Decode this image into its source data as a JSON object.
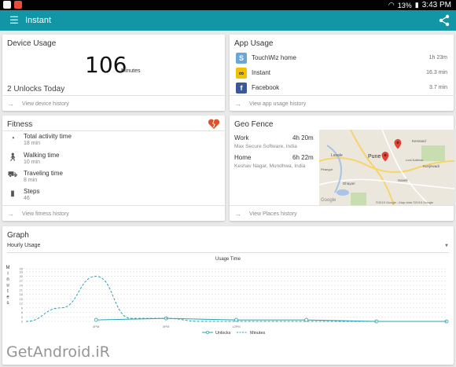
{
  "status_bar": {
    "battery": "13%",
    "time": "3:43 PM"
  },
  "app_bar": {
    "title": "Instant"
  },
  "device_usage": {
    "title": "Device Usage",
    "minutes": "106",
    "minutes_unit": "Minutes",
    "unlocks": "2 Unlocks Today",
    "link": "View device history"
  },
  "app_usage": {
    "title": "App Usage",
    "apps": [
      {
        "name": "TouchWiz home",
        "time": "1h 23m",
        "color": "#6aa7d8"
      },
      {
        "name": "Instant",
        "time": "16.3 min",
        "color": "#f2c100"
      },
      {
        "name": "Facebook",
        "time": "3.7 min",
        "color": "#3b5998"
      }
    ],
    "link": "View app usage history"
  },
  "fitness": {
    "title": "Fitness",
    "items": [
      {
        "label": "Total activity time",
        "value": "18 min"
      },
      {
        "label": "Walking time",
        "value": "10 min"
      },
      {
        "label": "Traveling time",
        "value": "8 min"
      },
      {
        "label": "Steps",
        "value": "46"
      }
    ],
    "link": "View fitness history"
  },
  "geo_fence": {
    "title": "Geo Fence",
    "places": [
      {
        "name": "Work",
        "time": "4h 20m",
        "address": "Max Secure Software, India"
      },
      {
        "name": "Home",
        "time": "6h 22m",
        "address": "Keshav Nagar, Mundhwa, India"
      }
    ],
    "link": "View Places history",
    "map": {
      "labels": [
        "Lavale",
        "Pune",
        "Kesnand",
        "Kunjirwadi",
        "Dhayari",
        "Google",
        "Haveli",
        "Loni Kalbhor",
        "Pirangut"
      ],
      "copyright": "©2015 Google - Map data ©2015 Google"
    }
  },
  "graph": {
    "title": "Graph",
    "selected": "Hourly Usage"
  },
  "chart_data": {
    "type": "line",
    "title": "Usage Time",
    "ylabel": "Minutes",
    "categories": [
      "",
      "",
      "4PM",
      "",
      "8PM",
      "",
      "12PM",
      "",
      "",
      "",
      "",
      "",
      ""
    ],
    "ylim": [
      0,
      35
    ],
    "yticks": [
      0,
      3,
      6,
      9,
      12,
      15,
      18,
      21,
      24,
      27,
      30,
      33,
      35
    ],
    "series": [
      {
        "name": "Unlocks",
        "color": "#26a3b0",
        "style": "solid",
        "values": [
          null,
          null,
          1,
          null,
          2,
          null,
          1,
          null,
          1,
          null,
          0,
          null,
          0
        ]
      },
      {
        "name": "Minutes",
        "color": "#26a3b0",
        "style": "dashed",
        "values": [
          0,
          9,
          30,
          2,
          2,
          0,
          0,
          0,
          0,
          0,
          0,
          0,
          0
        ]
      }
    ],
    "legend_position": "bottom"
  },
  "watermark": "GetAndroid.iR"
}
